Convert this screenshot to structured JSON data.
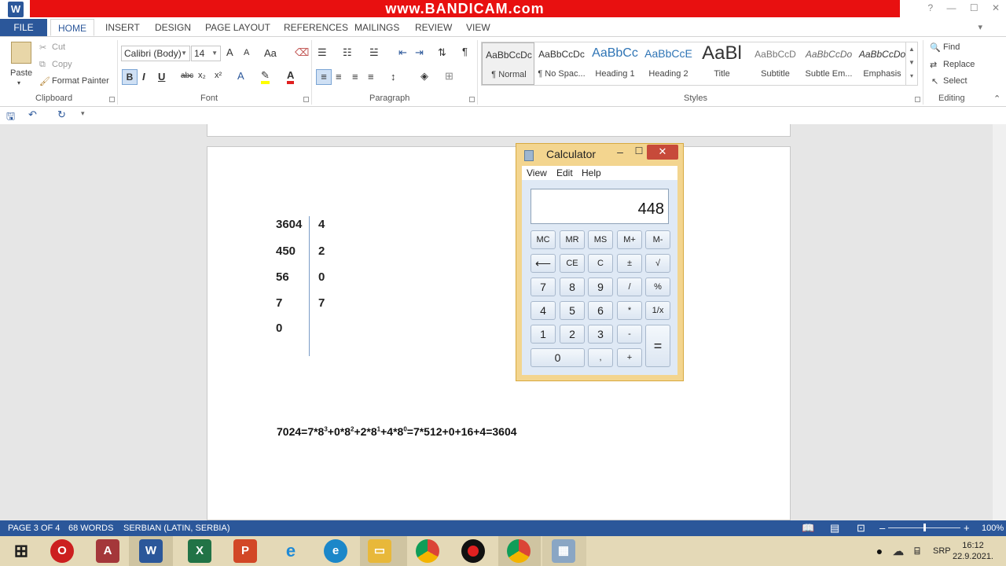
{
  "titlebar": {
    "recorder_watermark": "www.BANDICAM.com",
    "app_letter": "W",
    "help": "?",
    "controls": [
      "—",
      "☐",
      "✕"
    ]
  },
  "tabs": [
    "FILE",
    "HOME",
    "INSERT",
    "DESIGN",
    "PAGE LAYOUT",
    "REFERENCES",
    "MAILINGS",
    "REVIEW",
    "VIEW"
  ],
  "ribbon": {
    "clipboard": {
      "paste": "Paste",
      "cut": "Cut",
      "copy": "Copy",
      "format_painter": "Format Painter",
      "label": "Clipboard"
    },
    "font": {
      "family": "Calibri (Body)",
      "size": "14",
      "label": "Font",
      "grow": "A",
      "shrink": "A",
      "case": "Aa",
      "bold": "B",
      "italic": "I",
      "underline": "U",
      "strike": "abc",
      "sub": "x₂",
      "sup": "x²"
    },
    "paragraph": {
      "label": "Paragraph",
      "pilcrow": "¶"
    },
    "styles": {
      "label": "Styles",
      "items": [
        {
          "sample": "AaBbCcDc",
          "name": "¶ Normal"
        },
        {
          "sample": "AaBbCcDc",
          "name": "¶ No Spac..."
        },
        {
          "sample": "AaBbCc",
          "name": "Heading 1"
        },
        {
          "sample": "AaBbCcE",
          "name": "Heading 2"
        },
        {
          "sample": "AaBl",
          "name": "Title"
        },
        {
          "sample": "AaBbCcD",
          "name": "Subtitle"
        },
        {
          "sample": "AaBbCcDo",
          "name": "Subtle Em..."
        },
        {
          "sample": "AaBbCcDo",
          "name": "Emphasis"
        }
      ]
    },
    "editing": {
      "find": "Find",
      "replace": "Replace",
      "select": "Select",
      "label": "Editing"
    }
  },
  "document": {
    "dividends": [
      "3604",
      "450",
      "56",
      "7",
      "0"
    ],
    "remainders": [
      "4",
      "2",
      "0",
      "7"
    ],
    "equation": {
      "p1": "7024=7*8",
      "e1": "3",
      "p2": "+0*8",
      "e2": "2",
      "p3": "+2*8",
      "e3": "1",
      "p4": "+4*8",
      "e4": "0",
      "p5": "=7*512+0+16+4=3604"
    }
  },
  "calculator": {
    "title": "Calculator",
    "menu": [
      "View",
      "Edit",
      "Help"
    ],
    "display": "448",
    "close": "✕",
    "keys": {
      "mc": "MC",
      "mr": "MR",
      "ms": "MS",
      "mplus": "M+",
      "mminus": "M-",
      "back": "⟵",
      "ce": "CE",
      "c": "C",
      "pm": "±",
      "sqrt": "√",
      "k7": "7",
      "k8": "8",
      "k9": "9",
      "div": "/",
      "pct": "%",
      "k4": "4",
      "k5": "5",
      "k6": "6",
      "mul": "*",
      "inv": "1/x",
      "k1": "1",
      "k2": "2",
      "k3": "3",
      "sub": "-",
      "eq": "=",
      "k0": "0",
      "dot": ",",
      "add": "+"
    }
  },
  "statusbar": {
    "page": "PAGE 3 OF 4",
    "words": "68 WORDS",
    "language": "SERBIAN (LATIN, SERBIA)",
    "zoom": "100%",
    "zoom_fraction": 0.5
  },
  "taskbar": {
    "lang": "SRP",
    "time": "16:12",
    "date": "22.9.2021."
  }
}
